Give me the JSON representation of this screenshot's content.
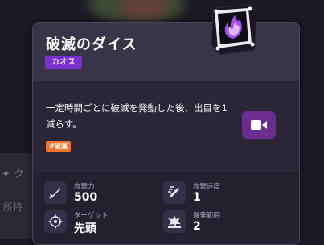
{
  "background": {
    "ghost_text_1": "✦ ク",
    "ghost_text_2": "所持"
  },
  "card": {
    "title": "破滅のダイス",
    "rarity": "カオス",
    "description_prefix": "一定時間ごとに",
    "description_keyword": "破滅",
    "description_suffix": "を発動した後、出目を1減らす。",
    "tag": "#破滅",
    "icons": {
      "dice": "chaos-dice-icon",
      "video": "video-camera-icon"
    },
    "colors": {
      "rarity": "#7a2fd0",
      "tag": "#f0762e",
      "video_button": "#6b2d8f"
    }
  },
  "stats": [
    {
      "label": "攻撃力",
      "value": "500",
      "icon": "sword-icon"
    },
    {
      "label": "攻撃速度",
      "value": "1",
      "icon": "attack-speed-icon"
    },
    {
      "label": "ターゲット",
      "value": "先頭",
      "icon": "target-icon"
    },
    {
      "label": "爆発範囲",
      "value": "2",
      "icon": "explosion-icon"
    }
  ]
}
